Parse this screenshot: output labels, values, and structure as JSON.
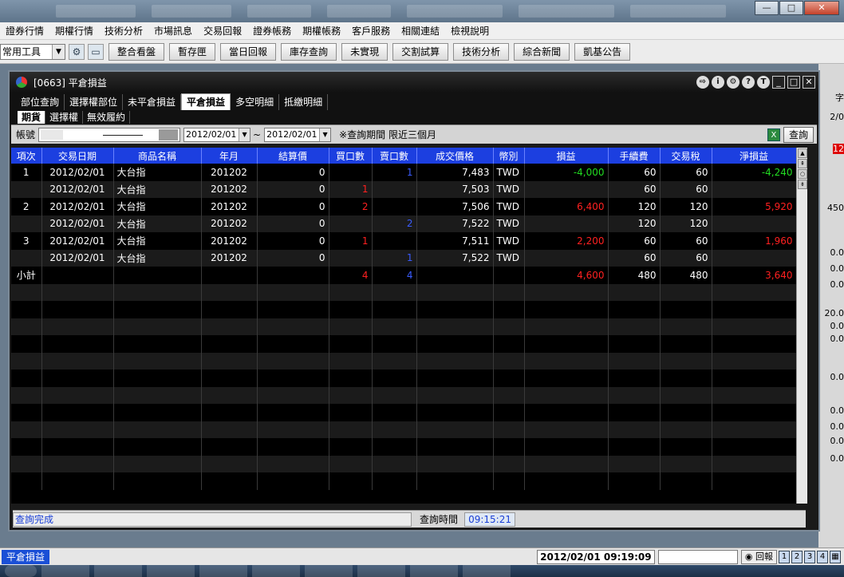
{
  "menu": [
    "證券行情",
    "期權行情",
    "技術分析",
    "市場訊息",
    "交易回報",
    "證券帳務",
    "期權帳務",
    "客戶服務",
    "相關連結",
    "檢視說明"
  ],
  "toolbar": {
    "select_value": "常用工具",
    "buttons": [
      "整合看盤",
      "暫存匣",
      "當日回報",
      "庫存查詢",
      "未實現",
      "交割試算",
      "技術分析",
      "綜合新聞",
      "凱基公告"
    ]
  },
  "child": {
    "title": "[0663] 平倉損益",
    "tabs": [
      "部位查詢",
      "選擇權部位",
      "未平倉損益",
      "平倉損益",
      "多空明細",
      "抵繳明細"
    ],
    "subtabs": [
      "期貨",
      "選擇權",
      "無效履約"
    ],
    "query": {
      "account_label": "帳號",
      "date_from": "2012/02/01",
      "tilde": "~",
      "date_to": "2012/02/01",
      "note": "※查詢期間 限近三個月",
      "query_button": "查詢"
    },
    "headers": [
      "項次",
      "交易日期",
      "商品名稱",
      "年月",
      "結算價",
      "買口數",
      "賣口數",
      "成交價格",
      "幣別",
      "損益",
      "手續費",
      "交易稅",
      "淨損益"
    ],
    "rows": [
      [
        "1",
        "2012/02/01",
        "大台指",
        "201202",
        "0",
        "",
        "1",
        "7,483",
        "TWD",
        "-4,000",
        "60",
        "60",
        "-4,240"
      ],
      [
        "",
        "2012/02/01",
        "大台指",
        "201202",
        "0",
        "1",
        "",
        "7,503",
        "TWD",
        "",
        "60",
        "60",
        ""
      ],
      [
        "2",
        "2012/02/01",
        "大台指",
        "201202",
        "0",
        "2",
        "",
        "7,506",
        "TWD",
        "6,400",
        "120",
        "120",
        "5,920"
      ],
      [
        "",
        "2012/02/01",
        "大台指",
        "201202",
        "0",
        "",
        "2",
        "7,522",
        "TWD",
        "",
        "120",
        "120",
        ""
      ],
      [
        "3",
        "2012/02/01",
        "大台指",
        "201202",
        "0",
        "1",
        "",
        "7,511",
        "TWD",
        "2,200",
        "60",
        "60",
        "1,960"
      ],
      [
        "",
        "2012/02/01",
        "大台指",
        "201202",
        "0",
        "",
        "1",
        "7,522",
        "TWD",
        "",
        "60",
        "60",
        ""
      ],
      [
        "小計",
        "",
        "",
        "",
        "",
        "4",
        "4",
        "",
        "",
        "4,600",
        "480",
        "480",
        "3,640"
      ]
    ],
    "status": {
      "message": "查詢完成",
      "time_label": "查詢時間",
      "time": "09:15:21"
    }
  },
  "right_strip": [
    "字",
    "2/0",
    "12",
    "450",
    "0.0",
    "0.0",
    "0.0",
    "20.0",
    "0.0",
    "0.0",
    "0.0",
    "0.0",
    "0.0",
    "0.0",
    "0.0"
  ],
  "app_status": {
    "active_tab": "平倉損益",
    "clock": "2012/02/01 09:19:09",
    "report_button": "回報",
    "page_nums": [
      "1",
      "2",
      "3",
      "4"
    ]
  },
  "colors": {
    "header_blue": "#1c3fe0",
    "profit_red": "#ff2020",
    "loss_green": "#22dd22",
    "sell_blue": "#3a5cff"
  }
}
